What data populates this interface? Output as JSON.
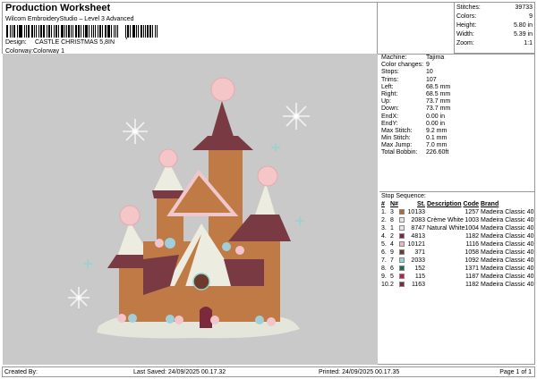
{
  "header": {
    "title": "Production Worksheet",
    "subtitle": "Wilcom EmbroideryStudio – Level 3 Advanced",
    "barcode_suffix": ",",
    "design_label": "Design:",
    "design": "CASTLE CHRISTMAS 5,8IN",
    "colorway_label": "Colorway:",
    "colorway": "Colorway 1"
  },
  "summary": [
    {
      "k": "Stitches:",
      "v": "39733"
    },
    {
      "k": "Colors:",
      "v": "9"
    },
    {
      "k": "Height:",
      "v": "5.80 in"
    },
    {
      "k": "Width:",
      "v": "5.39 in"
    },
    {
      "k": "Zoom:",
      "v": "1:1"
    }
  ],
  "params": [
    {
      "k": "Machine:",
      "v": "Tajima"
    },
    {
      "k": "Color changes:",
      "v": "9"
    },
    {
      "k": "Stops:",
      "v": "10"
    },
    {
      "k": "Trims:",
      "v": "107"
    },
    {
      "k": "Left:",
      "v": "68.5 mm"
    },
    {
      "k": "Right:",
      "v": "68.5 mm"
    },
    {
      "k": "Up:",
      "v": "73.7 mm"
    },
    {
      "k": "Down:",
      "v": "73.7 mm"
    },
    {
      "k": "EndX:",
      "v": "0.00 in"
    },
    {
      "k": "EndY:",
      "v": "0.00 in"
    },
    {
      "k": "Max Stitch:",
      "v": "9.2 mm"
    },
    {
      "k": "Min Stitch:",
      "v": "0.1 mm"
    },
    {
      "k": "Max Jump:",
      "v": "7.0 mm"
    },
    {
      "k": "Total Bobbin:",
      "v": "226.60ft"
    }
  ],
  "stop_sequence": {
    "title": "Stop Sequence:",
    "headers": [
      "#",
      "N#",
      "St.",
      "Description",
      "Code",
      "Brand"
    ],
    "rows": [
      {
        "i": "1.",
        "n": "3",
        "color": "#b5652e",
        "st": "10133",
        "desc": "",
        "code": "1257",
        "brand": "Madeira Classic 40"
      },
      {
        "i": "2.",
        "n": "8",
        "color": "#e8e6e0",
        "st": "2083",
        "desc": "Crème White",
        "code": "1003",
        "brand": "Madeira Classic 40"
      },
      {
        "i": "3.",
        "n": "1",
        "color": "#e6e6ee",
        "st": "8747",
        "desc": "Natural White",
        "code": "1004",
        "brand": "Madeira Classic 40"
      },
      {
        "i": "4.",
        "n": "2",
        "color": "#7a2a3a",
        "st": "4813",
        "desc": "",
        "code": "1182",
        "brand": "Madeira Classic 40"
      },
      {
        "i": "5.",
        "n": "4",
        "color": "#f2b4c4",
        "st": "10121",
        "desc": "",
        "code": "1116",
        "brand": "Madeira Classic 40"
      },
      {
        "i": "6.",
        "n": "9",
        "color": "#6e3a2c",
        "st": "371",
        "desc": "",
        "code": "1058",
        "brand": "Madeira Classic 40"
      },
      {
        "i": "7.",
        "n": "7",
        "color": "#9fd0da",
        "st": "2033",
        "desc": "",
        "code": "1092",
        "brand": "Madeira Classic 40"
      },
      {
        "i": "8.",
        "n": "6",
        "color": "#1f6b55",
        "st": "152",
        "desc": "",
        "code": "1371",
        "brand": "Madeira Classic 40"
      },
      {
        "i": "9.",
        "n": "5",
        "color": "#d0154a",
        "st": "115",
        "desc": "",
        "code": "1187",
        "brand": "Madeira Classic 40"
      },
      {
        "i": "10.",
        "n": "2",
        "color": "#7a2a3a",
        "st": "1163",
        "desc": "",
        "code": "1182",
        "brand": "Madeira Classic 40"
      }
    ]
  },
  "footer": {
    "created_by": "Created By:",
    "last_saved": "Last Saved: 24/09/2025 00.17.32",
    "printed": "Printed: 24/09/2025 00.17.35",
    "page": "Page 1 of 1"
  }
}
